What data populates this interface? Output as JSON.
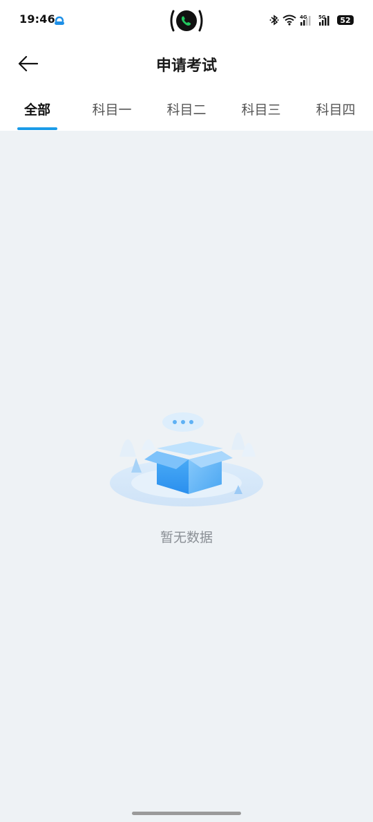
{
  "status_bar": {
    "time": "19:46",
    "app_icon": "cloud-notification-icon",
    "call_icon": "phone-call-icon",
    "right_icons": [
      "bluetooth-icon",
      "wifi-icon",
      "signal-4g-icon",
      "signal-5g-icon"
    ],
    "signal_4g_label": "4G",
    "signal_5g_label": "5G",
    "battery_level": "52"
  },
  "header": {
    "back_icon": "arrow-left-icon",
    "title": "申请考试"
  },
  "tabs": [
    {
      "label": "全部",
      "active": true
    },
    {
      "label": "科目一",
      "active": false
    },
    {
      "label": "科目二",
      "active": false
    },
    {
      "label": "科目三",
      "active": false
    },
    {
      "label": "科目四",
      "active": false
    }
  ],
  "empty_state": {
    "illustration": "empty-box-icon",
    "text": "暂无数据"
  },
  "colors": {
    "accent": "#1b9be8",
    "background": "#eef2f5",
    "surface": "#ffffff",
    "text_primary": "#111111",
    "text_secondary": "#555555",
    "text_muted": "#8a8f95"
  }
}
